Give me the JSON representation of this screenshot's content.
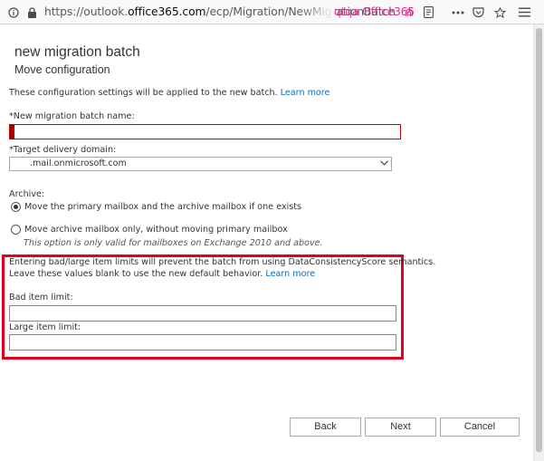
{
  "browser": {
    "url_prefix": "https://outlook.",
    "url_host": "office365.com",
    "url_path": "/ecp/Migration/NewMigrationBatch",
    "container_label": "qtqa Office365"
  },
  "dialog": {
    "title": "new migration batch",
    "subtitle": "Move configuration",
    "intro_text": "These configuration settings will be applied to the new batch.",
    "intro_link": "Learn more",
    "batch_name_label": "*New migration batch name:",
    "batch_name_value": "",
    "domain_label": "*Target delivery domain:",
    "domain_value": ".mail.onmicrosoft.com",
    "archive_label": "Archive:",
    "archive_options": [
      {
        "label": "Move the primary mailbox and the archive mailbox if one exists",
        "checked": true
      },
      {
        "label": "Move archive mailbox only, without moving primary mailbox",
        "checked": false
      }
    ],
    "archive_note": "This option is only valid for mailboxes on Exchange 2010 and above.",
    "limits_line1": "Entering bad/large item limits will prevent the batch from using DataConsistencyScore semantics.",
    "limits_line2": "Leave these values blank to use the new default behavior.",
    "limits_link": "Learn more",
    "bad_item_label": "Bad item limit:",
    "bad_item_value": "",
    "large_item_label": "Large item limit:",
    "large_item_value": ""
  },
  "buttons": {
    "back": "Back",
    "next": "Next",
    "cancel": "Cancel"
  },
  "colors": {
    "highlight": "#e3001b",
    "link": "#0072c6",
    "container": "#e0278e"
  }
}
